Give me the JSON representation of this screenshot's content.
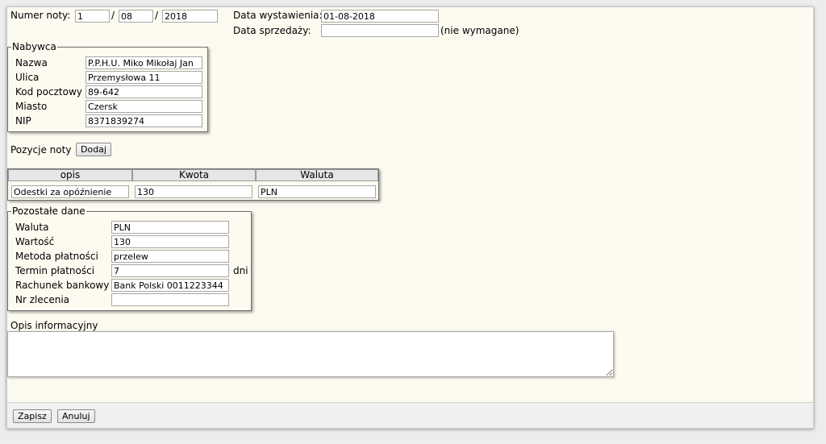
{
  "header": {
    "numer_label": "Numer noty:",
    "numer_part1": "1",
    "numer_part2": "08",
    "numer_part3": "2018",
    "slash": "/",
    "data_wystawienia_label": "Data wystawienia:",
    "data_wystawienia_value": "01-08-2018",
    "data_sprzedazy_label": "Data sprzedaży:",
    "data_sprzedazy_value": "",
    "data_sprzedazy_note": "(nie wymagane)"
  },
  "nabywca": {
    "legend": "Nabywca",
    "fields": [
      {
        "label": "Nazwa",
        "value": "P.P.H.U. Miko Mikołaj Jan"
      },
      {
        "label": "Ulica",
        "value": "Przemysłowa 11"
      },
      {
        "label": "Kod pocztowy",
        "value": "89-642"
      },
      {
        "label": "Miasto",
        "value": "Czersk"
      },
      {
        "label": "NIP",
        "value": "8371839274"
      }
    ]
  },
  "pozycje": {
    "label": "Pozycje noty",
    "add_button": "Dodaj",
    "columns": [
      "opis",
      "Kwota",
      "Waluta"
    ],
    "rows": [
      {
        "opis": "Odestki za opóźnienie",
        "kwota": "130",
        "waluta": "PLN"
      }
    ]
  },
  "pozostale": {
    "legend": "Pozostałe dane",
    "fields": [
      {
        "label": "Waluta",
        "value": "PLN"
      },
      {
        "label": "Wartość",
        "value": "130"
      },
      {
        "label": "Metoda płatności",
        "value": "przelew"
      },
      {
        "label": "Termin płatności",
        "value": "7"
      },
      {
        "label": "Rachunek bankowy",
        "value": "Bank Polski 0011223344"
      },
      {
        "label": "Nr zlecenia",
        "value": ""
      }
    ],
    "termin_unit": "dni"
  },
  "opis_informacyjny": {
    "label": "Opis informacyjny",
    "value": ""
  },
  "footer": {
    "save_label": "Zapisz",
    "cancel_label": "Anuluj"
  }
}
